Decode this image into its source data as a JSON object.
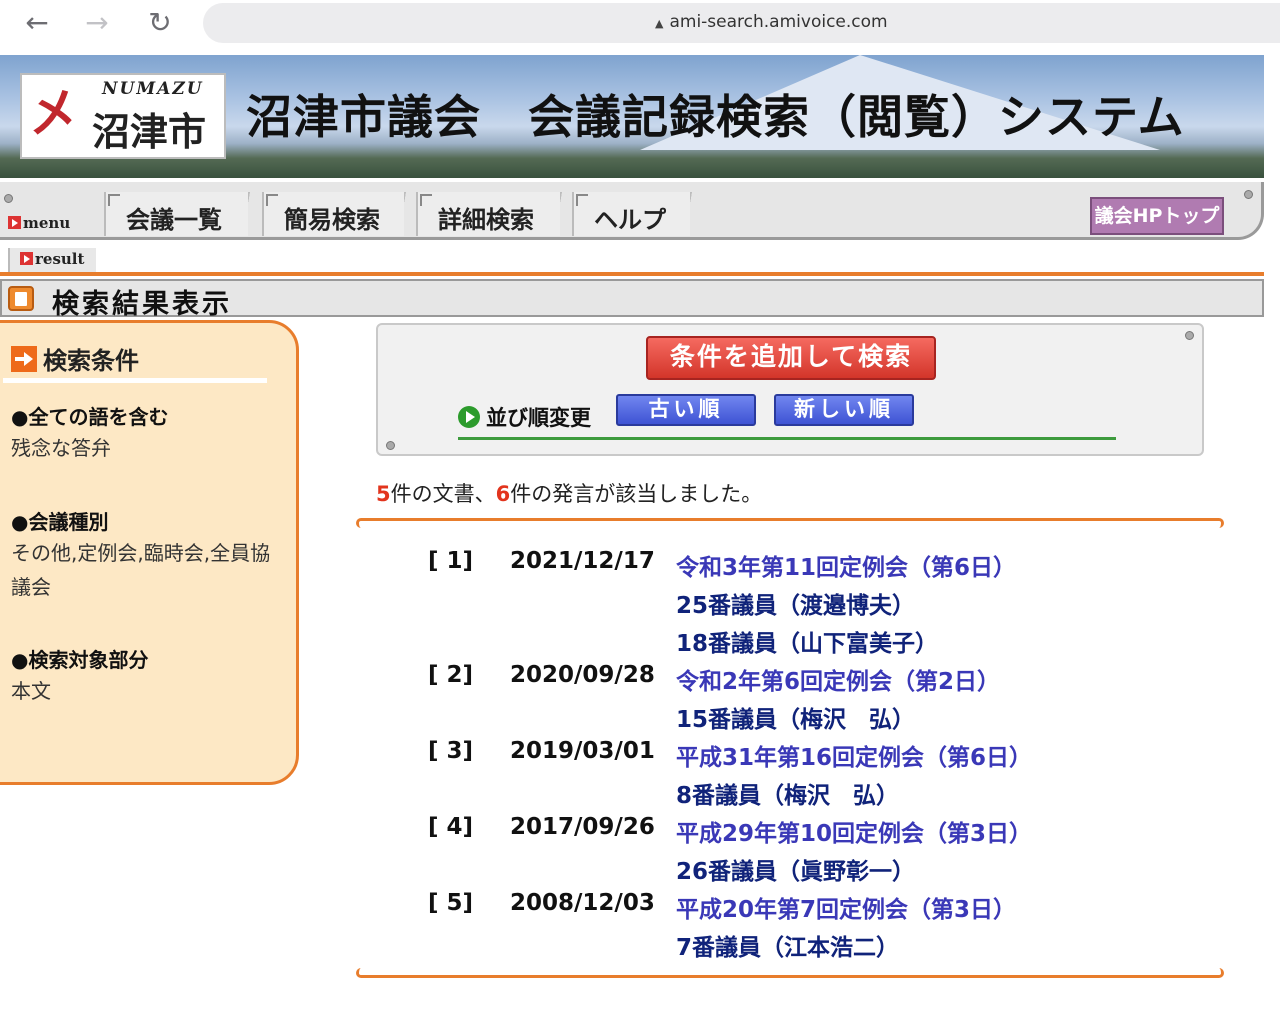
{
  "browser": {
    "url": "ami-search.amivoice.com",
    "back_icon": "←",
    "forward_icon": "→",
    "reload_icon": "↻",
    "lock_icon": "▲"
  },
  "header": {
    "logo_mark": "㐅",
    "logo_en": "NUMAZU",
    "logo_jp": "沼津市",
    "site_title": "沼津市議会　会議記録検索（閲覧）システム"
  },
  "menu": {
    "label": "menu",
    "tabs": [
      "会議一覧",
      "簡易検索",
      "詳細検索",
      "ヘルプ"
    ],
    "hp_button": "議会HPトップ"
  },
  "result_tab": "result",
  "page_title": "検索結果表示",
  "conditions": {
    "title": "検索条件",
    "items": [
      {
        "label": "●全ての語を含む",
        "value": "残念な答弁"
      },
      {
        "label": "●会議種別",
        "value": "その他,定例会,臨時会,全員協議会"
      },
      {
        "label": "●検索対象部分",
        "value": "本文"
      }
    ]
  },
  "controls": {
    "add_search_button": "条件を追加して検索",
    "sort_label": "並び順変更",
    "sort_old": "古い順",
    "sort_new": "新しい順"
  },
  "summary": {
    "doc_count": "5",
    "part1": "件の文書、",
    "speech_count": "6",
    "part2": "件の発言が該当しました。"
  },
  "results": [
    {
      "index": "[ 1]",
      "date": "2021/12/17",
      "meeting": "令和3年第11回定例会（第6日）",
      "speakers": [
        "25番議員（渡邉博夫）",
        "18番議員（山下富美子）"
      ]
    },
    {
      "index": "[ 2]",
      "date": "2020/09/28",
      "meeting": "令和2年第6回定例会（第2日）",
      "speakers": [
        "15番議員（梅沢　弘）"
      ]
    },
    {
      "index": "[ 3]",
      "date": "2019/03/01",
      "meeting": "平成31年第16回定例会（第6日）",
      "speakers": [
        "8番議員（梅沢　弘）"
      ]
    },
    {
      "index": "[ 4]",
      "date": "2017/09/26",
      "meeting": "平成29年第10回定例会（第3日）",
      "speakers": [
        "26番議員（眞野彰一）"
      ]
    },
    {
      "index": "[ 5]",
      "date": "2008/12/03",
      "meeting": "平成20年第7回定例会（第3日）",
      "speakers": [
        "7番議員（江本浩二）"
      ]
    }
  ],
  "colors": {
    "accent_orange": "#e87d2c",
    "link_blue": "#3a38b7",
    "count_red": "#e2341d"
  }
}
